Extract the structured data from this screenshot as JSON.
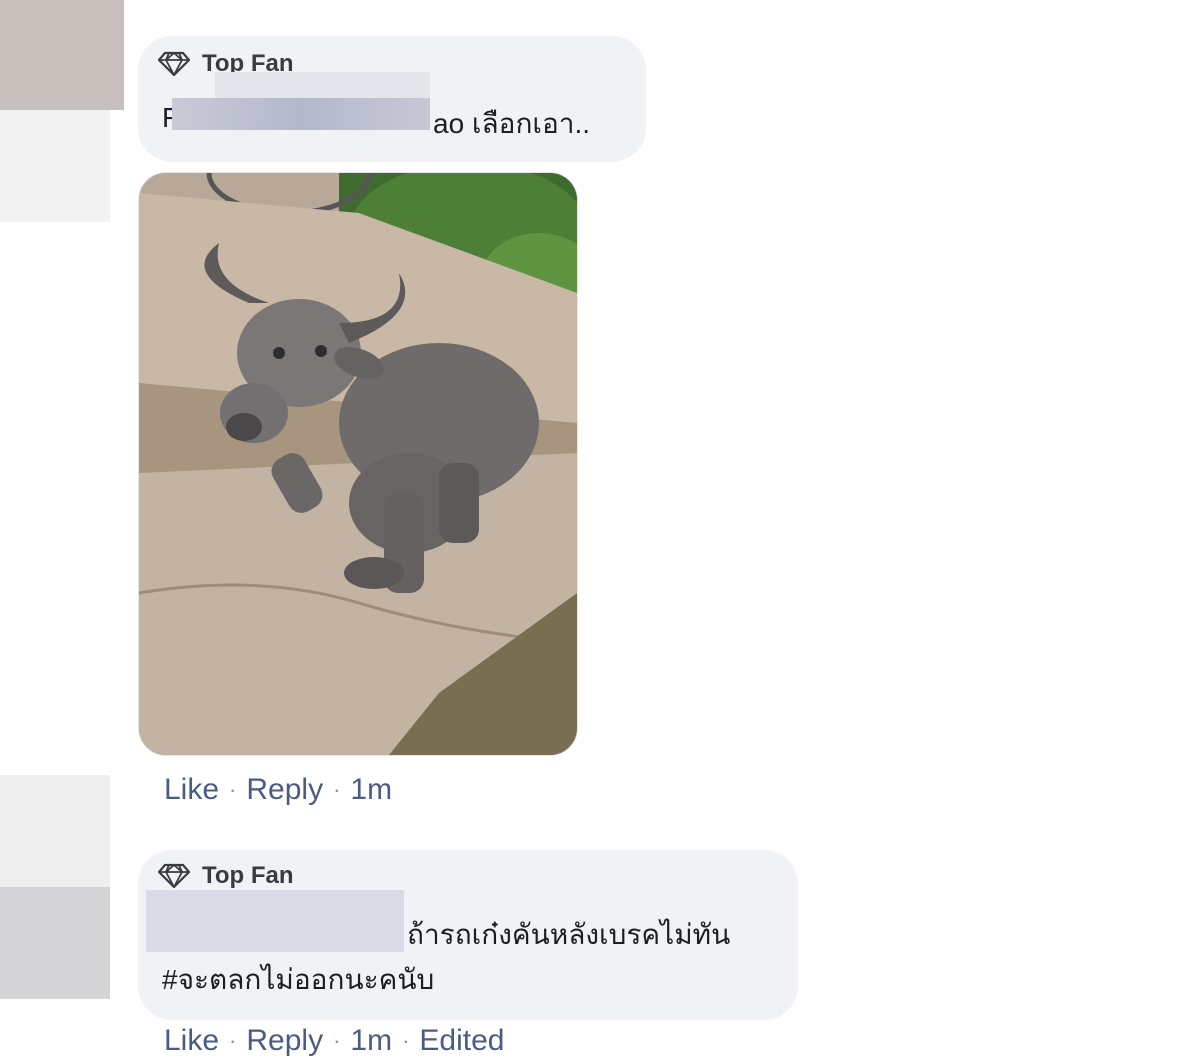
{
  "comments": [
    {
      "badge_label": "Top Fan",
      "badge_icon": "diamond-icon",
      "text_prefix": "F",
      "text": "ao เลือกเอา..",
      "has_photo": true,
      "actions": {
        "like": "Like",
        "reply": "Reply",
        "time": "1m"
      }
    },
    {
      "badge_label": "Top Fan",
      "badge_icon": "diamond-icon",
      "text_line1": "ถ้ารถเก๋งคันหลังเบรคไม่ทัน",
      "text_line2": "#จะตลกไม่ออกนะคนับ",
      "actions": {
        "like": "Like",
        "reply": "Reply",
        "time": "1m",
        "edited": "Edited"
      }
    }
  ],
  "separator": "·",
  "colors": {
    "bubble_bg": "#f0f2f5",
    "action_link": "#4b5b82",
    "meta_text": "#65676b"
  }
}
